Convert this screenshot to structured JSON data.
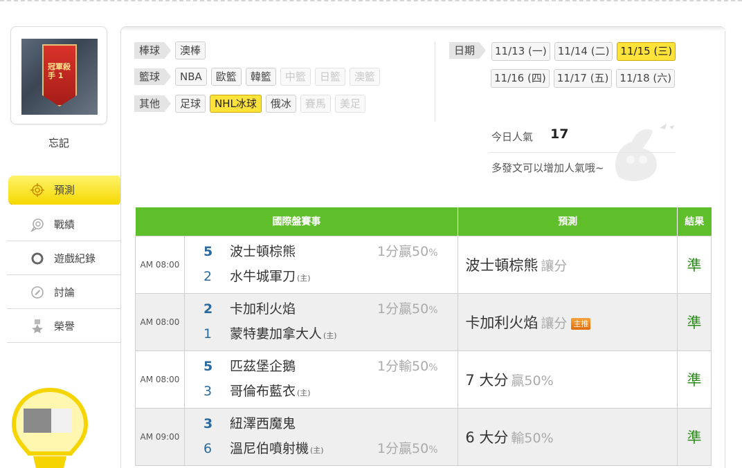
{
  "user": {
    "name": "忘記",
    "avatar_text": "冠軍殺手 1"
  },
  "menu": [
    {
      "label": "預測",
      "icon": "target-icon",
      "active": true
    },
    {
      "label": "戰績",
      "icon": "chat-icon"
    },
    {
      "label": "遊戲紀錄",
      "icon": "circle-icon"
    },
    {
      "label": "討論",
      "icon": "discussion-icon"
    },
    {
      "label": "榮譽",
      "icon": "medal-icon"
    }
  ],
  "filters": {
    "baseball": {
      "label": "棒球",
      "chips": [
        {
          "label": "澳棒"
        }
      ]
    },
    "basketball": {
      "label": "籃球",
      "chips": [
        {
          "label": "NBA"
        },
        {
          "label": "歐籃"
        },
        {
          "label": "韓籃"
        },
        {
          "label": "中籃",
          "disabled": true
        },
        {
          "label": "日籃",
          "disabled": true
        },
        {
          "label": "澳籃",
          "disabled": true
        }
      ]
    },
    "other": {
      "label": "其他",
      "chips": [
        {
          "label": "足球"
        },
        {
          "label": "NHL冰球",
          "selected": true
        },
        {
          "label": "俄冰"
        },
        {
          "label": "賽馬",
          "disabled": true
        },
        {
          "label": "美足",
          "disabled": true
        }
      ]
    }
  },
  "dates": {
    "label": "日期",
    "row1": [
      {
        "label": "11/13 (一)"
      },
      {
        "label": "11/14 (二)"
      },
      {
        "label": "11/15 (三)",
        "selected": true
      }
    ],
    "row2": [
      {
        "label": "11/16 (四)"
      },
      {
        "label": "11/17 (五)"
      },
      {
        "label": "11/18 (六)"
      }
    ]
  },
  "popularity": {
    "label": "今日人氣",
    "value": "17",
    "note": "多發文可以增加人氣哦~"
  },
  "table": {
    "headers": {
      "match": "國際盤賽事",
      "prediction": "預測",
      "result": "結果"
    },
    "rows": [
      {
        "time": "AM 08:00",
        "away": {
          "score": "5",
          "team": "波士頓棕熊"
        },
        "home": {
          "score": "2",
          "team": "水牛城軍刀",
          "host": "(主)"
        },
        "odds": "1分贏",
        "odds_pct": "50",
        "odds_unit": "%",
        "odds_pos": "top",
        "pred_main": "波士頓棕熊",
        "pred_sub": "讓分",
        "badge": "",
        "result": "準"
      },
      {
        "time": "AM 08:00",
        "away": {
          "score": "2",
          "team": "卡加利火焰"
        },
        "home": {
          "score": "1",
          "team": "蒙特婁加拿大人",
          "host": "(主)"
        },
        "odds": "1分贏",
        "odds_pct": "50",
        "odds_unit": "%",
        "odds_pos": "top",
        "pred_main": "卡加利火焰",
        "pred_sub": "讓分",
        "badge": "主推",
        "result": "準"
      },
      {
        "time": "AM 08:00",
        "away": {
          "score": "5",
          "team": "匹茲堡企鵝"
        },
        "home": {
          "score": "3",
          "team": "哥倫布藍衣",
          "host": "(主)"
        },
        "odds": "1分輸",
        "odds_pct": "50",
        "odds_unit": "%",
        "odds_pos": "top",
        "pred_main": "7 大分",
        "pred_sub": "贏50%",
        "badge": "",
        "result": "準"
      },
      {
        "time": "AM 09:00",
        "away": {
          "score": "3",
          "team": "紐澤西魔鬼"
        },
        "home": {
          "score": "6",
          "team": "溫尼伯噴射機",
          "host": "(主)"
        },
        "odds": "1分贏",
        "odds_pct": "50",
        "odds_unit": "%",
        "odds_pos": "bottom",
        "pred_main": "6 大分",
        "pred_sub": "輸50%",
        "badge": "",
        "result": "準"
      }
    ]
  }
}
